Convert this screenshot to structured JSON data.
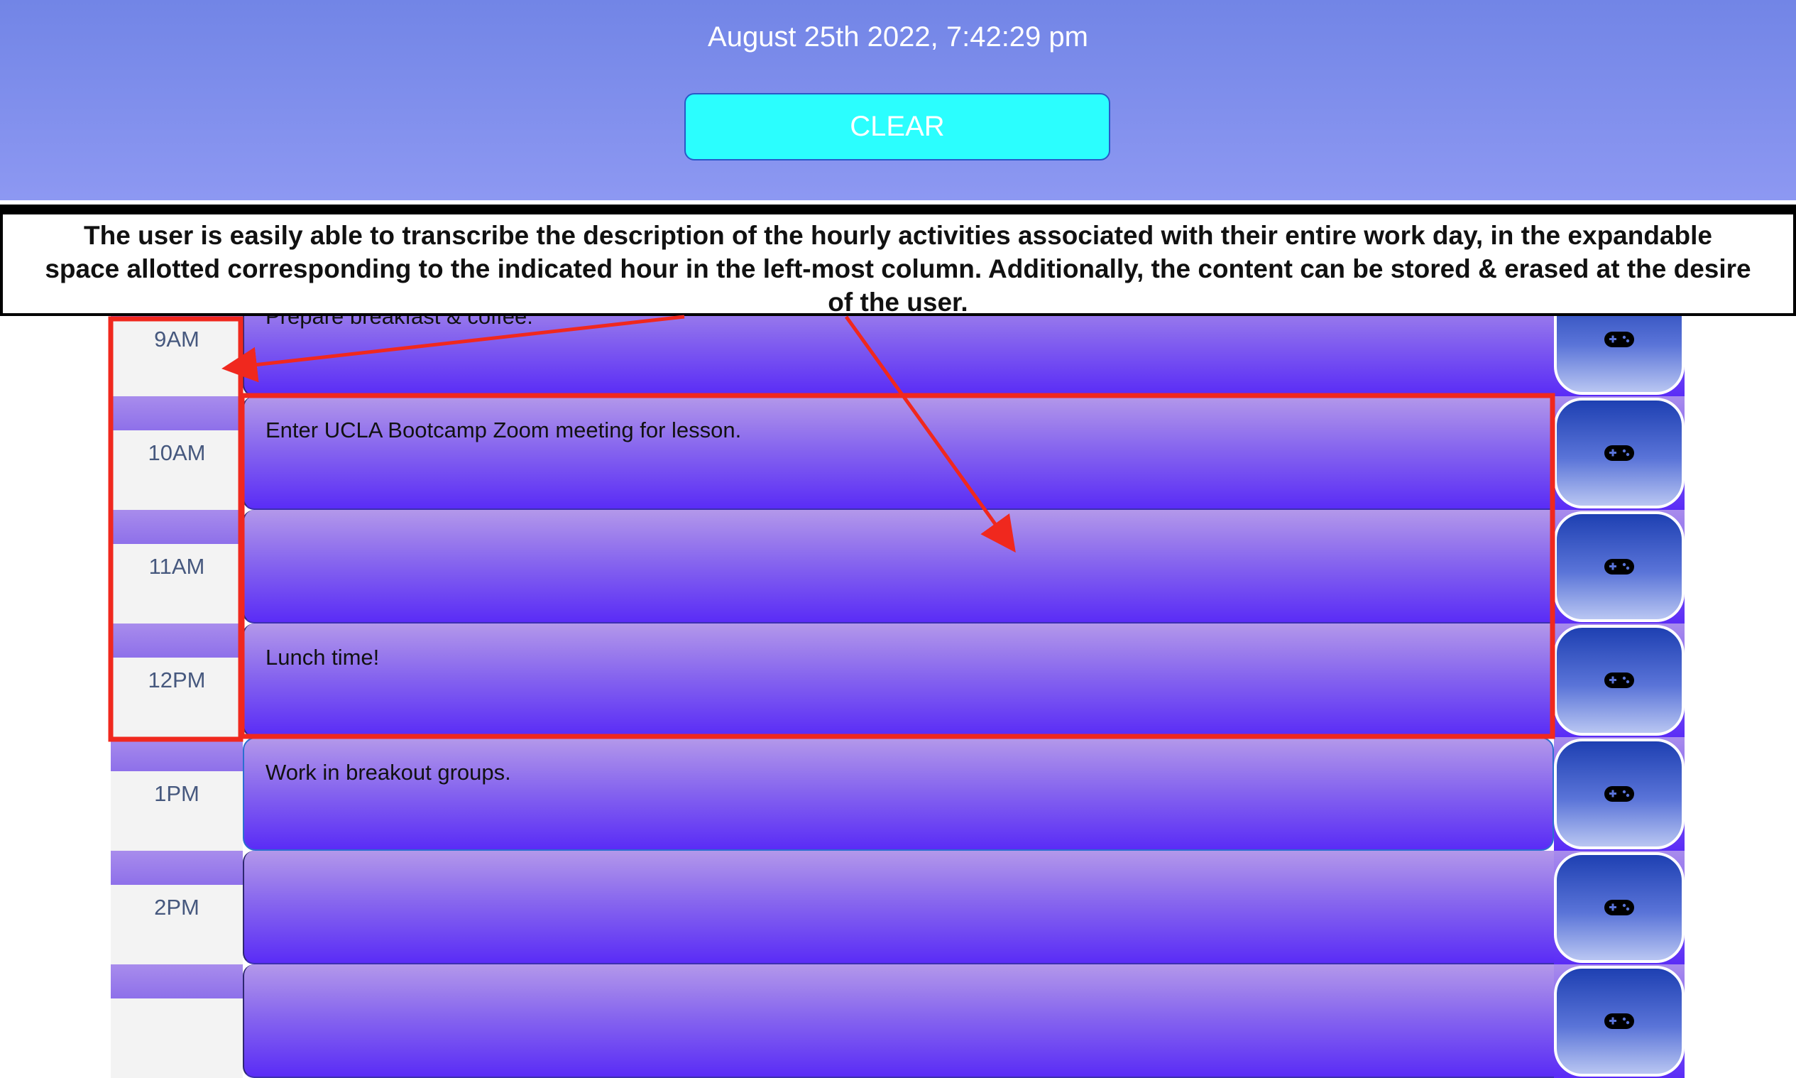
{
  "header": {
    "datetime": "August 25th 2022, 7:42:29 pm",
    "clear_label": "CLEAR"
  },
  "annotation": {
    "line1": "The user is easily able to transcribe the description of the hourly activities associated with their entire work day, in the expandable",
    "line2": "space allotted corresponding to the indicated hour in the left-most column. Additionally, the content can be stored & erased at the desire",
    "line3": "of the user."
  },
  "rows": [
    {
      "hour": "9AM",
      "description": "Prepare breakfast & coffee."
    },
    {
      "hour": "10AM",
      "description": "Enter UCLA Bootcamp Zoom meeting for lesson."
    },
    {
      "hour": "11AM",
      "description": ""
    },
    {
      "hour": "12PM",
      "description": "Lunch time!"
    },
    {
      "hour": "1PM",
      "description": "Work in breakout groups."
    },
    {
      "hour": "2PM",
      "description": ""
    },
    {
      "hour": "",
      "description": ""
    }
  ],
  "icons": {
    "save": "gamepad-icon"
  },
  "colors": {
    "header_top": "#7285e6",
    "clear_button": "#2bfefe",
    "row_gradient_top": "#b398ea",
    "row_gradient_bottom": "#5a2cf6",
    "save_button": "#1e40b2",
    "annotation_red": "#f0281e"
  }
}
